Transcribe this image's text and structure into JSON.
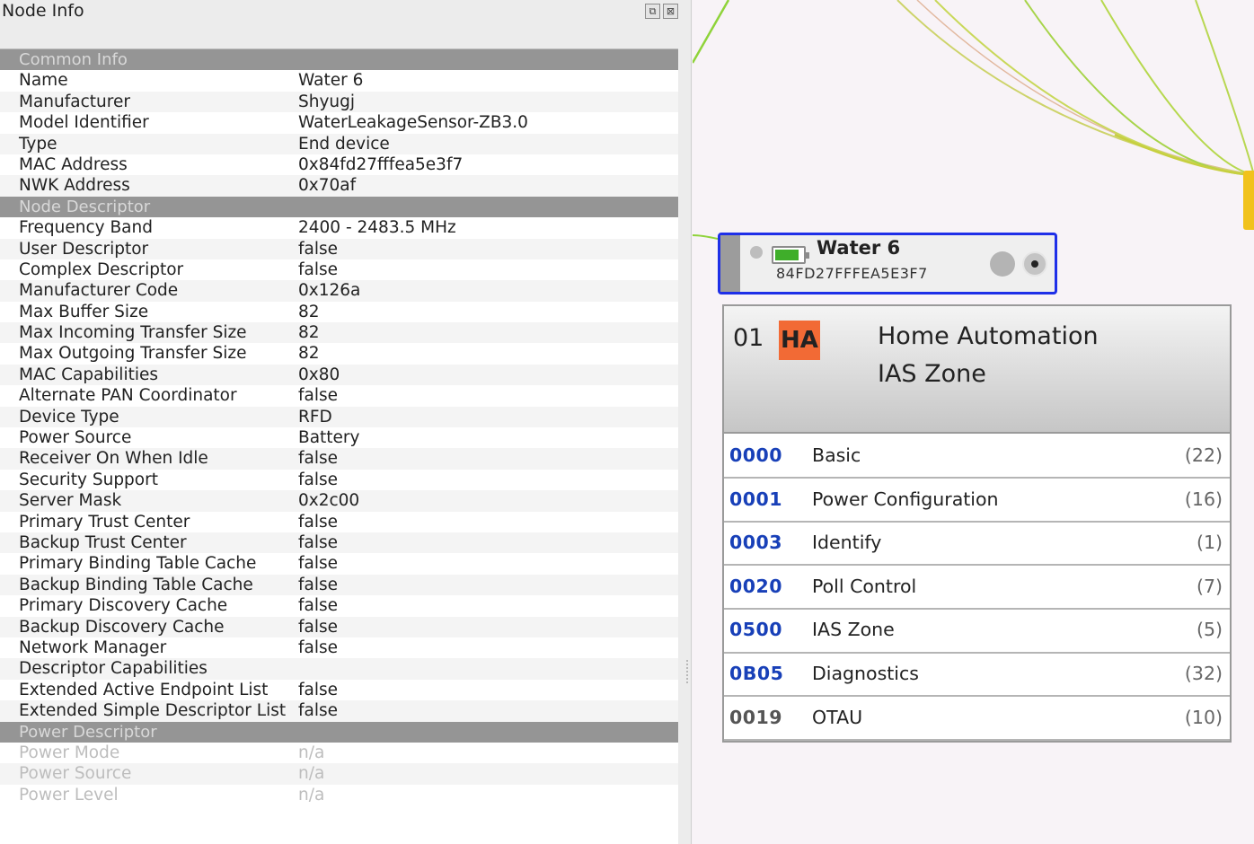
{
  "panel": {
    "title": "Node Info",
    "float_icon": "⧉",
    "close_icon": "⊠"
  },
  "sections": [
    {
      "title": "Common Info",
      "dim": false,
      "rows": [
        {
          "key": "Name",
          "value": "Water 6"
        },
        {
          "key": "Manufacturer",
          "value": "Shyugj"
        },
        {
          "key": "Model Identifier",
          "value": "WaterLeakageSensor-ZB3.0"
        },
        {
          "key": "Type",
          "value": "End device"
        },
        {
          "key": "MAC Address",
          "value": "0x84fd27fffea5e3f7"
        },
        {
          "key": "NWK Address",
          "value": "0x70af"
        }
      ]
    },
    {
      "title": "Node Descriptor",
      "dim": false,
      "rows": [
        {
          "key": "Frequency Band",
          "value": "2400 - 2483.5 MHz"
        },
        {
          "key": "User Descriptor",
          "value": "false"
        },
        {
          "key": "Complex Descriptor",
          "value": "false"
        },
        {
          "key": "Manufacturer Code",
          "value": "0x126a"
        },
        {
          "key": "Max Buffer Size",
          "value": "82"
        },
        {
          "key": "Max Incoming Transfer Size",
          "value": "82"
        },
        {
          "key": "Max Outgoing Transfer Size",
          "value": "82"
        },
        {
          "key": "MAC Capabilities",
          "value": "0x80"
        },
        {
          "key": "Alternate PAN Coordinator",
          "value": "false"
        },
        {
          "key": "Device Type",
          "value": "RFD"
        },
        {
          "key": "Power Source",
          "value": "Battery"
        },
        {
          "key": "Receiver On When Idle",
          "value": "false"
        },
        {
          "key": "Security Support",
          "value": "false"
        },
        {
          "key": "Server Mask",
          "value": "0x2c00"
        },
        {
          "key": "Primary Trust Center",
          "value": "false"
        },
        {
          "key": "Backup Trust Center",
          "value": "false"
        },
        {
          "key": "Primary Binding Table Cache",
          "value": "false"
        },
        {
          "key": "Backup Binding Table Cache",
          "value": "false"
        },
        {
          "key": "Primary Discovery Cache",
          "value": "false"
        },
        {
          "key": "Backup Discovery Cache",
          "value": "false"
        },
        {
          "key": "Network Manager",
          "value": "false"
        },
        {
          "key": "Descriptor Capabilities",
          "value": ""
        },
        {
          "key": "Extended Active Endpoint List",
          "value": "false"
        },
        {
          "key": "Extended Simple Descriptor List",
          "value": "false"
        }
      ]
    },
    {
      "title": "Power Descriptor",
      "dim": true,
      "rows": [
        {
          "key": "Power Mode",
          "value": "n/a"
        },
        {
          "key": "Power Source",
          "value": "n/a"
        },
        {
          "key": "Power Level",
          "value": "n/a"
        }
      ]
    }
  ],
  "node": {
    "name": "Water 6",
    "mac": "84FD27FFFEA5E3F7",
    "battery_level": 0.85,
    "battery_color": "#3fae2a",
    "border_color": "#1f2fe8"
  },
  "endpoint": {
    "id": "01",
    "badge": "HA",
    "badge_color": "#f26a35",
    "profile": "Home Automation",
    "device": "IAS Zone",
    "clusters": [
      {
        "id": "0000",
        "name": "Basic",
        "count": "(22)",
        "server": true
      },
      {
        "id": "0001",
        "name": "Power Configuration",
        "count": "(16)",
        "server": true
      },
      {
        "id": "0003",
        "name": "Identify",
        "count": "(1)",
        "server": true
      },
      {
        "id": "0020",
        "name": "Poll Control",
        "count": "(7)",
        "server": true
      },
      {
        "id": "0500",
        "name": "IAS Zone",
        "count": "(5)",
        "server": true
      },
      {
        "id": "0B05",
        "name": "Diagnostics",
        "count": "(32)",
        "server": true
      },
      {
        "id": "0019",
        "name": "OTAU",
        "count": "(10)",
        "server": false
      }
    ]
  },
  "colors": {
    "server_cluster": "#1840b8",
    "client_cluster": "#555555",
    "link_green": "#8fd33a",
    "link_yellow": "#d8d96b"
  }
}
